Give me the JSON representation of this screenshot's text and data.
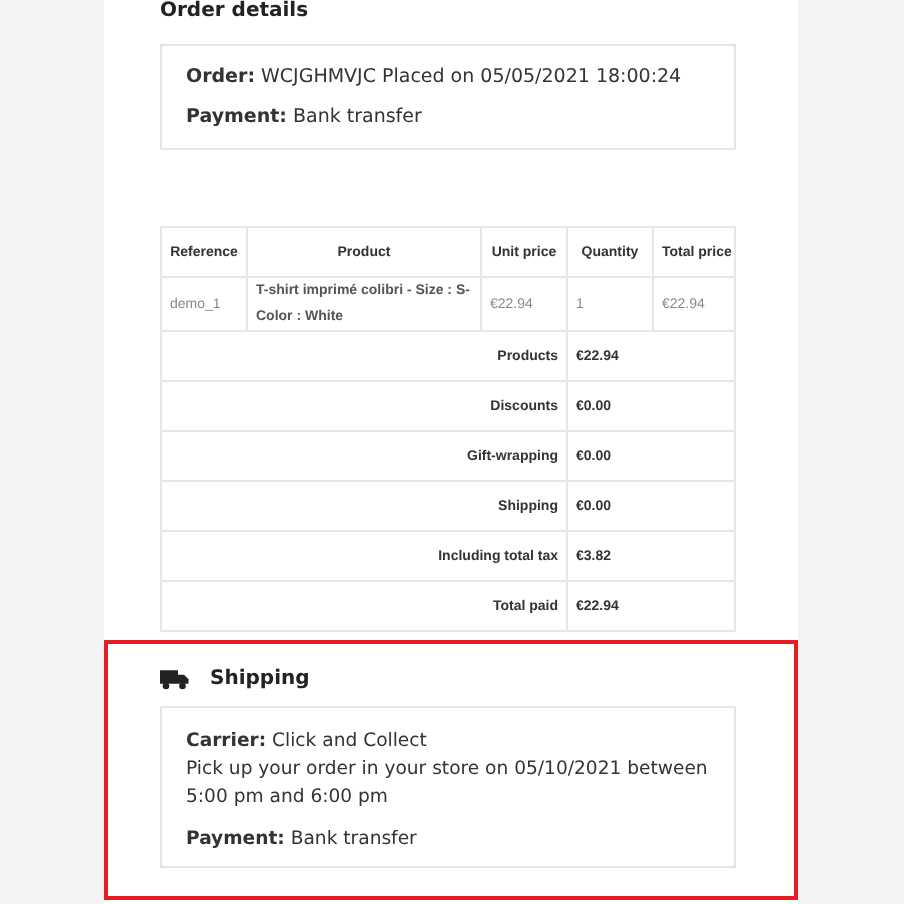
{
  "order_details": {
    "title": "Order details",
    "lines": [
      "**Order:** WCJGHMVJC Placed on 05/05/2021 18:00:24",
      "**Payment:** Bank transfer"
    ]
  },
  "table": {
    "columns": [
      "Reference",
      "Product",
      "Unit price",
      "Quantity",
      "Total price"
    ],
    "rows": [
      [
        "demo_1",
        "T-shirt imprimé colibri - Size : S- Color : White",
        "€22.94",
        "1",
        "€22.94"
      ]
    ],
    "totals": [
      {
        "label": "Products",
        "value": "€22.94"
      },
      {
        "label": "Discounts",
        "value": "€0.00"
      },
      {
        "label": "Gift-wrapping",
        "value": "€0.00"
      },
      {
        "label": "Shipping",
        "value": "€0.00"
      },
      {
        "label": "Including total tax",
        "value": "€3.82"
      },
      {
        "label": "Total paid",
        "value": "€22.94"
      }
    ]
  },
  "shipping": {
    "title": "Shipping",
    "lines": [
      {
        "kind": "text",
        "text": "**Carrier:** Click and Collect"
      },
      {
        "kind": "text",
        "text": "Pick up your order in your store on 05/10/2021 between 5:00 pm and 6:00 pm"
      },
      {
        "kind": "gap"
      },
      {
        "kind": "text",
        "text": "**Payment:** Bank transfer"
      }
    ]
  }
}
